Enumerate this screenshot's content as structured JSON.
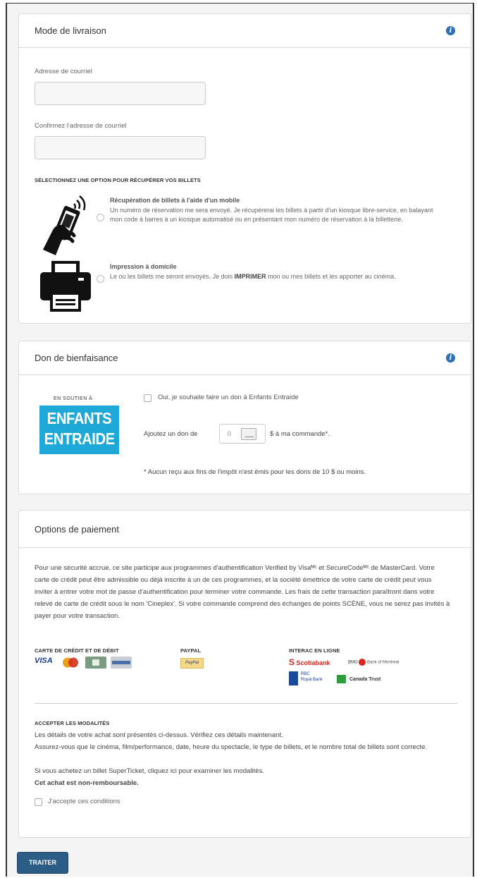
{
  "delivery": {
    "title": "Mode de livraison",
    "email_label": "Adresse de courriel",
    "confirm_label": "Confirmez l'adresse de courriel",
    "options_heading": "SÉLECTIONNEZ UNE OPTION POUR RÉCUPÉRER VOS BILLETS",
    "mobile_title": "Récupération de billets à l'aide d'un mobile",
    "mobile_desc": "Un numéro de réservation me sera envoyé. Je récupérerai les billets à partir d'un kiosque libre-service, en balayant mon code à barres à un kiosque automatisé ou en présentant mon numéro de réservation à la billetterie.",
    "print_title": "Impression à domicile",
    "print_desc_1": "Le ou les billets me seront envoyés. Je dois ",
    "print_desc_bold": "IMPRIMER",
    "print_desc_2": " mon ou mes billets et les apporter au cinéma."
  },
  "donation": {
    "title": "Don de bienfaisance",
    "logo_top": "EN SOUTIEN À",
    "logo_line1": "ENFANTS",
    "logo_line2": "ENTRAIDE",
    "checkbox_label": "Oui, je souhaite faire un don à Enfants Entraide",
    "amount_prefix": "Ajoutez un don de",
    "amount_value": "0",
    "amount_suffix": "$ à ma commande*.",
    "footnote": "* Aucun reçu aux fins de l'impôt n'est émis pour les dons de 10 $ ou moins."
  },
  "payment": {
    "title": "Options de paiement",
    "security_text": "Pour une sécurité accrue, ce site participe aux programmes d'authentification Verified by Visaᴹᶜ et SecureCodeᴹᶜ de MasterCard. Votre carte de crédit peut être admissible ou déjà inscrite à un de ces programmes, et la société émettrice de votre carte de crédit peut vous inviter à entrer votre mot de passe d'authentification pour terminer votre commande. Les frais de cette transaction paraîtront dans votre relevé de carte de crédit sous le nom 'Cineplex'. Si votre commande comprend des échanges de points SCÈNE, vous ne serez pas invités à payer pour votre transaction.",
    "card_heading": "CARTE DE CRÉDIT ET DE DÉBIT",
    "paypal_heading": "PAYPAL",
    "interac_heading": "INTERAC EN LIGNE",
    "visa": "VISA",
    "paypal": "PayPal",
    "bank_scotia": "Scotiabank",
    "bank_bmo": "BMO",
    "bank_bmo_sub": "Bank of Montreal",
    "bank_rbc_top": "RBC",
    "bank_rbc": "Royal Bank",
    "bank_td": "Canada Trust",
    "terms_heading": "ACCEPTER LES MODALITÉS",
    "terms_1": "Les détails de votre achat sont présentés ci-dessus. Vérifiez ces détails maintenant.",
    "terms_2": "Assurez-vous que le cinéma, film/performance, date, heure du spectacle, le type de billets, et le nombre total de billets sont correcte.",
    "terms_3": "Si vous achetez un billet SuperTicket, cliquez ici pour examiner les modalités.",
    "terms_4": "Cet achat est non-remboursable.",
    "accept_label": "J'accepte ces conditions"
  },
  "submit_label": "TRAITER",
  "colors": {
    "primary_button": "#2c5d87",
    "info": "#2f6dba",
    "charity": "#1ea8d8"
  }
}
